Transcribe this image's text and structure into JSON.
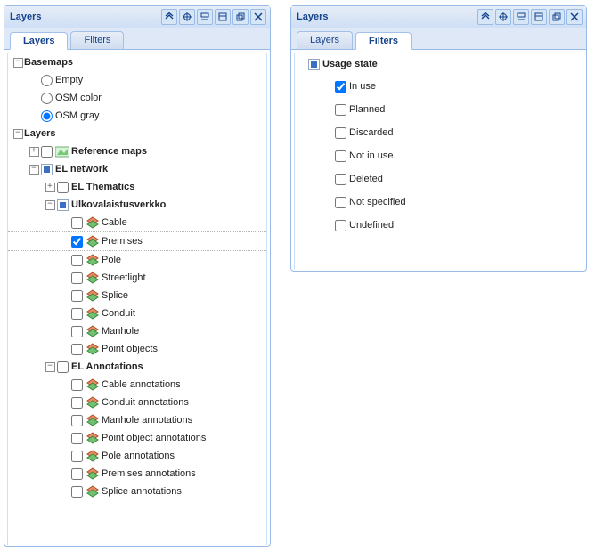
{
  "left": {
    "title": "Layers",
    "tabs": {
      "layers": "Layers",
      "filters": "Filters"
    },
    "groups": {
      "basemaps": "Basemaps",
      "basemap_options": [
        "Empty",
        "OSM color",
        "OSM gray"
      ],
      "basemap_selected": 2,
      "layers": "Layers",
      "reference_maps": "Reference maps",
      "el_network": "EL network",
      "el_thematics": "EL Thematics",
      "ulkovalaistusverkko": "Ulkovalaistusverkko",
      "ulko_children": [
        "Cable",
        "Premises",
        "Pole",
        "Streetlight",
        "Splice",
        "Conduit",
        "Manhole",
        "Point objects"
      ],
      "ulko_checked_index": 1,
      "el_annotations": "EL Annotations",
      "ann_children": [
        "Cable annotations",
        "Conduit annotations",
        "Manhole annotations",
        "Point object annotations",
        "Pole annotations",
        "Premises annotations",
        "Splice annotations"
      ]
    }
  },
  "right": {
    "title": "Layers",
    "tabs": {
      "layers": "Layers",
      "filters": "Filters"
    },
    "filter_group": "Usage state",
    "options": [
      "In use",
      "Planned",
      "Discarded",
      "Not in use",
      "Deleted",
      "Not specified",
      "Undefined"
    ],
    "checked_index": 0
  }
}
